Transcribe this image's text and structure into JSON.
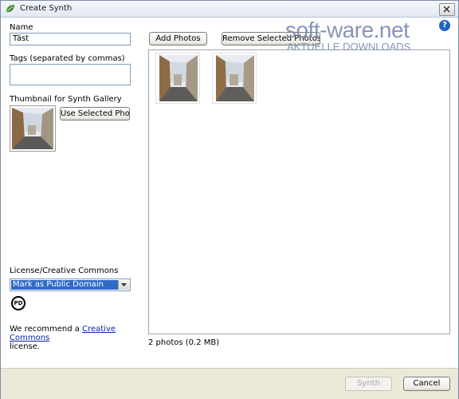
{
  "window": {
    "title": "Create Synth",
    "close_icon": "close-icon",
    "app_icon": "synth-leaf-icon"
  },
  "form": {
    "name_label": "Name",
    "name_value": "Täst",
    "tags_label": "Tags (separated by commas)",
    "tags_value": "",
    "thumbnail_label": "Thumbnail for Synth Gallery",
    "use_selected_photo": "Use Selected Photo",
    "license_label": "License/Creative Commons",
    "license_selected": "Mark as Public Domain",
    "pd_badge_text": "PD",
    "recommend_text_before": "We recommend a ",
    "recommend_link": "Creative Commons",
    "recommend_text_after": "license."
  },
  "photos": {
    "add_photos": "Add Photos",
    "remove_selected": "Remove Selected Photos",
    "summary": "2 photos (0.2 MB)",
    "items": [
      "street-photo-1",
      "street-photo-2"
    ]
  },
  "footer": {
    "synth_button": "Synth",
    "cancel_button": "Cancel"
  },
  "watermark": {
    "main": "soft-ware.net",
    "sub": "AKTUELLE DOWNLOADS",
    "help": "?"
  },
  "colors": {
    "selection": "#316ac5",
    "link": "#0a24a6",
    "watermark": "#7b89b5"
  }
}
